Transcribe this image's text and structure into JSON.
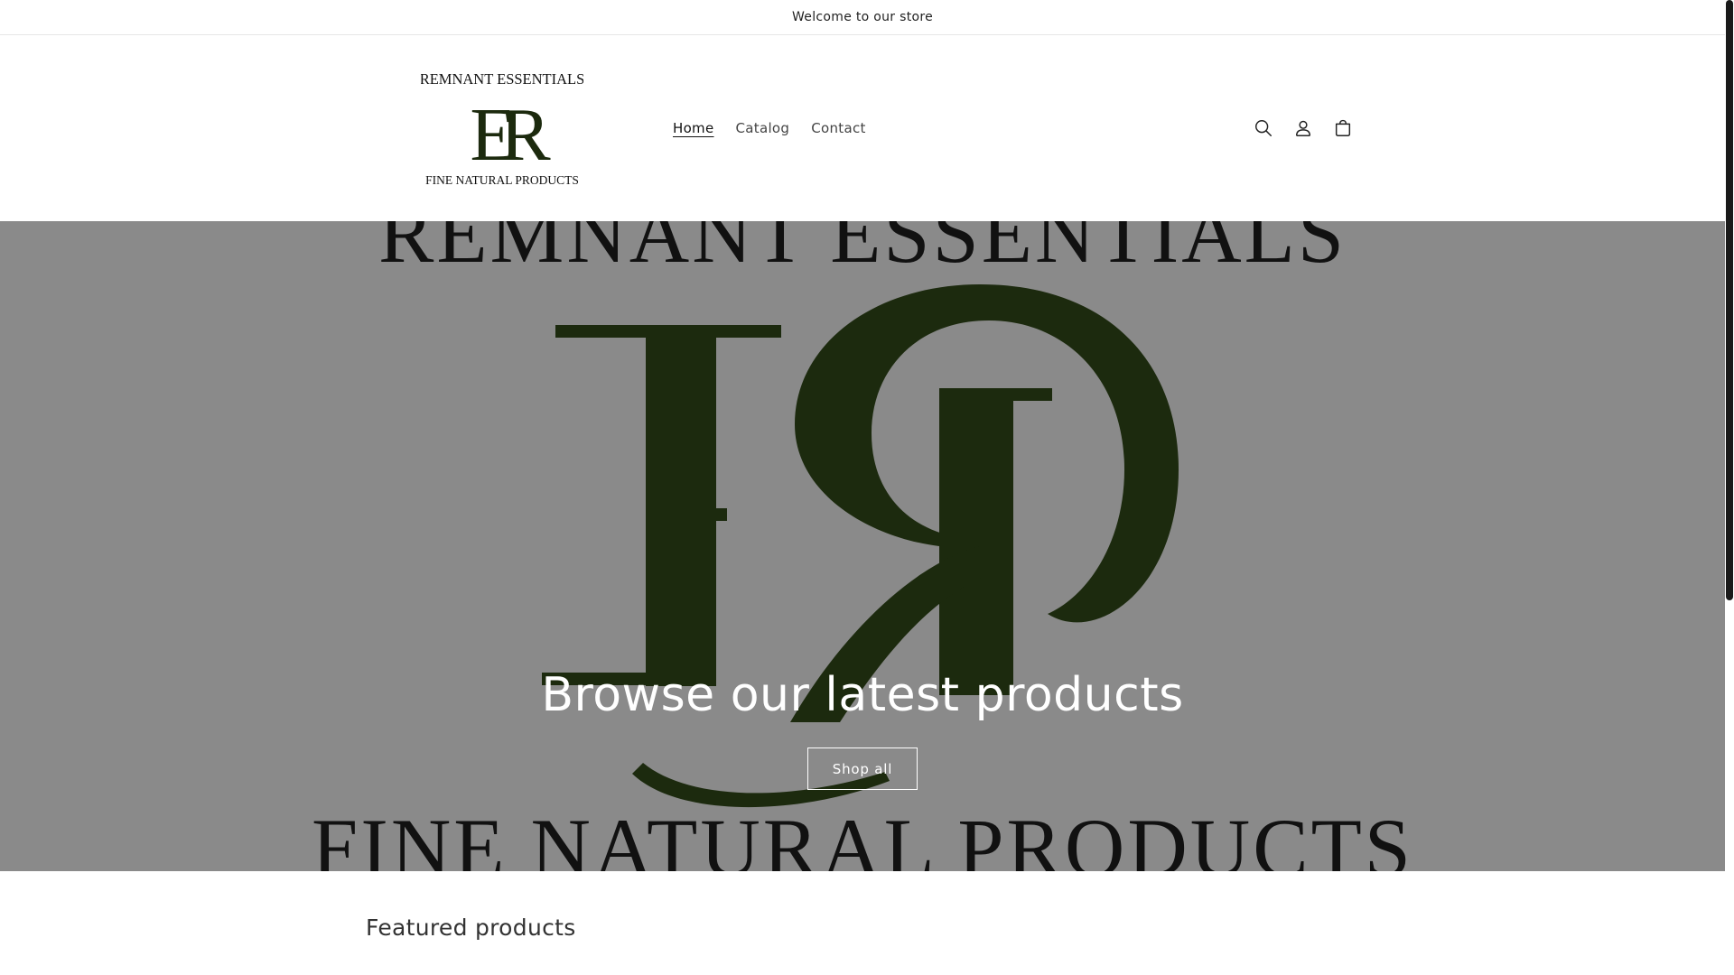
{
  "announcement": {
    "text": "Welcome to our store"
  },
  "brand": {
    "name_top": "REMNANT ESSENTIALS",
    "monogram": "ER",
    "name_bottom": "FINE NATURAL PRODUCTS",
    "logo_color": "#1c2a0e"
  },
  "nav": {
    "items": [
      {
        "label": "Home",
        "active": true
      },
      {
        "label": "Catalog",
        "active": false
      },
      {
        "label": "Contact",
        "active": false
      }
    ]
  },
  "header_icons": [
    "search-icon",
    "account-icon",
    "cart-icon"
  ],
  "hero": {
    "top_text": "REMNANT ESSENTIALS",
    "bottom_text": "FINE NATURAL PRODUCTS",
    "title": "Browse our latest products",
    "button_label": "Shop all",
    "overlay_color": "#8a8a8a"
  },
  "featured": {
    "title": "Featured products"
  }
}
